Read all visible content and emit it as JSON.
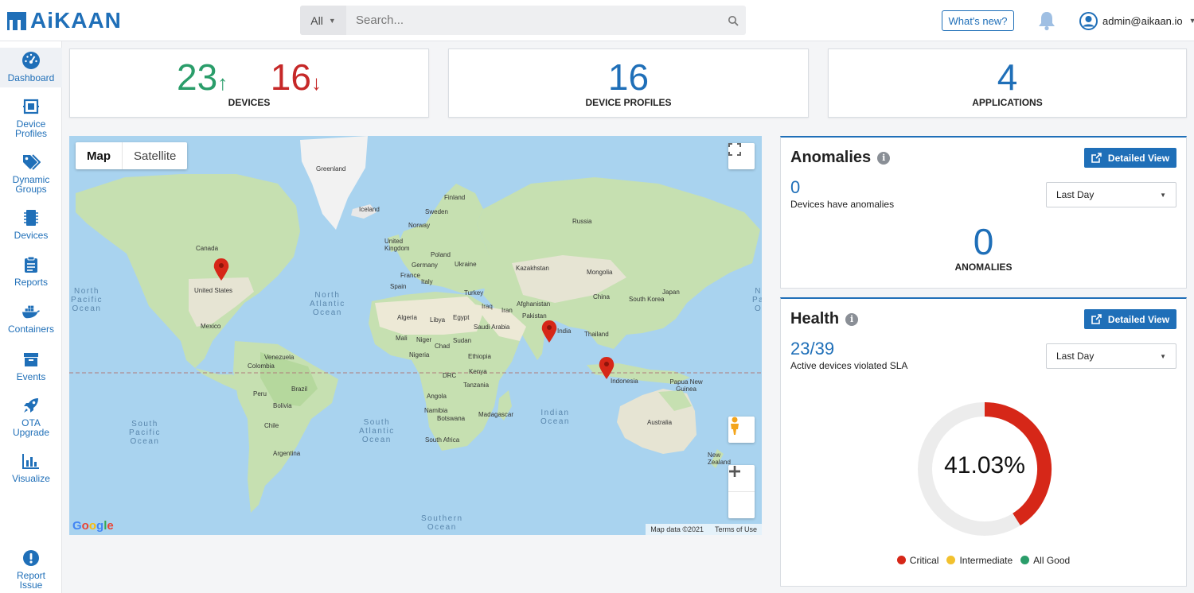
{
  "app": {
    "logo_text": "AiKAAN"
  },
  "search": {
    "scope": "All",
    "placeholder": "Search..."
  },
  "header": {
    "whats_new": "What's new?",
    "user": "admin@aikaan.io"
  },
  "sidebar": {
    "items": [
      {
        "label_1": "Dashboard",
        "label_2": "",
        "icon": "dashboard-icon"
      },
      {
        "label_1": "Device",
        "label_2": "Profiles",
        "icon": "device-profiles-icon"
      },
      {
        "label_1": "Dynamic",
        "label_2": "Groups",
        "icon": "tags-icon"
      },
      {
        "label_1": "Devices",
        "label_2": "",
        "icon": "chip-icon"
      },
      {
        "label_1": "Reports",
        "label_2": "",
        "icon": "clipboard-icon"
      },
      {
        "label_1": "Containers",
        "label_2": "",
        "icon": "docker-icon"
      },
      {
        "label_1": "Events",
        "label_2": "",
        "icon": "archive-icon"
      },
      {
        "label_1": "OTA",
        "label_2": "Upgrade",
        "icon": "rocket-icon"
      },
      {
        "label_1": "Visualize",
        "label_2": "",
        "icon": "bar-chart-icon"
      }
    ],
    "report": {
      "label_1": "Report",
      "label_2": "Issue"
    }
  },
  "stats": {
    "devices_up": "23",
    "devices_up_arrow": "↑",
    "devices_down": "16",
    "devices_down_arrow": "↓",
    "devices_label": "DEVICES",
    "profiles": "16",
    "profiles_label": "DEVICE PROFILES",
    "applications": "4",
    "applications_label": "APPLICATIONS"
  },
  "map": {
    "tab_map": "Map",
    "tab_satellite": "Satellite",
    "attribution": "Map data ©2021",
    "terms": "Terms of Use",
    "google": "Google",
    "oceans": {
      "north_pacific": [
        "North",
        "Pacific",
        "Ocean"
      ],
      "north_atlantic": [
        "North",
        "Atlantic",
        "Ocean"
      ],
      "south_pacific": [
        "South",
        "Pacific",
        "Ocean"
      ],
      "south_atlantic": [
        "South",
        "Atlantic",
        "Ocean"
      ],
      "indian": [
        "Indian",
        "Ocean"
      ],
      "southern": [
        "Southern",
        "Ocean"
      ],
      "east_pacific": [
        "N",
        "Pa",
        "O"
      ]
    },
    "places": [
      "Greenland",
      "Iceland",
      "Finland",
      "Sweden",
      "Norway",
      "Russia",
      "Canada",
      "United States",
      "Mexico",
      "United Kingdom",
      "Poland",
      "Germany",
      "Ukraine",
      "France",
      "Italy",
      "Spain",
      "Kazakhstan",
      "Mongolia",
      "China",
      "South Korea",
      "Japan",
      "Turkey",
      "Iraq",
      "Iran",
      "Afghanistan",
      "Pakistan",
      "India",
      "Thailand",
      "Algeria",
      "Libya",
      "Egypt",
      "Saudi Arabia",
      "Mali",
      "Niger",
      "Chad",
      "Sudan",
      "Nigeria",
      "Ethiopia",
      "DRC",
      "Kenya",
      "Tanzania",
      "Angola",
      "Namibia",
      "Botswana",
      "South Africa",
      "Madagascar",
      "Venezuela",
      "Colombia",
      "Peru",
      "Brazil",
      "Bolivia",
      "Chile",
      "Argentina",
      "Indonesia",
      "Papua New Guinea",
      "Australia",
      "New Zealand"
    ]
  },
  "anomalies": {
    "title": "Anomalies",
    "detailed_view": "Detailed View",
    "count": "0",
    "count_label": "Devices have anomalies",
    "range": "Last Day",
    "total": "0",
    "total_label": "ANOMALIES"
  },
  "health": {
    "title": "Health",
    "detailed_view": "Detailed View",
    "ratio": "23/39",
    "ratio_label": "Active devices violated SLA",
    "range": "Last Day",
    "percent_label": "41.03%",
    "percent": 41.03,
    "legend": [
      {
        "label": "Critical",
        "color": "#d62718"
      },
      {
        "label": "Intermediate",
        "color": "#f2c12e"
      },
      {
        "label": "All Good",
        "color": "#2a9d6a"
      }
    ]
  }
}
